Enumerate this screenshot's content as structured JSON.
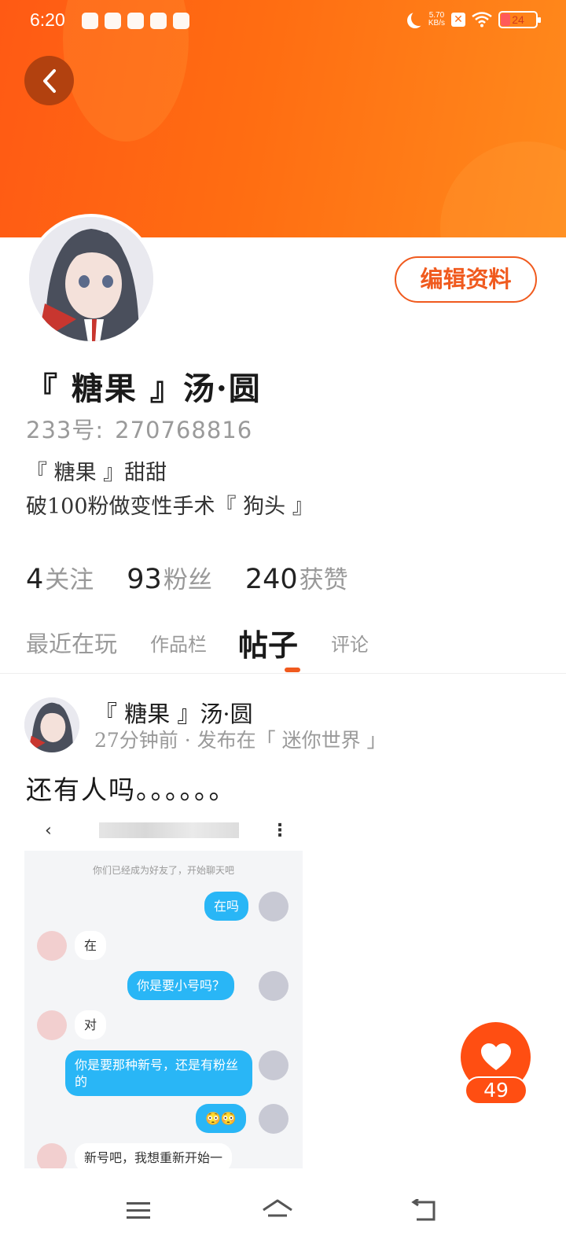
{
  "status_bar": {
    "time": "6:20",
    "net_speed_value": "5.70",
    "net_speed_unit": "KB/s",
    "battery": "24"
  },
  "profile": {
    "edit_label": "编辑资料",
    "username": "『 糖果 』汤·圆",
    "id_label": "233号:",
    "id_value": "270768816",
    "bio_line1": "『 糖果 』甜甜",
    "bio_line2": "破100粉做变性手术『 狗头 』"
  },
  "stats": [
    {
      "num": "4",
      "label": "关注"
    },
    {
      "num": "93",
      "label": "粉丝"
    },
    {
      "num": "240",
      "label": "获赞"
    }
  ],
  "tabs": [
    "最近在玩",
    "作品栏",
    "帖子",
    "评论"
  ],
  "active_tab": "帖子",
  "post": {
    "author": "『 糖果 』汤·圆",
    "meta": "27分钟前 · 发布在「 迷你世界 」",
    "text": "还有人吗。。。。。。",
    "likes": "49"
  },
  "chat_screenshot": {
    "system": "你们已经成为好友了，开始聊天吧",
    "messages": [
      {
        "from": "me",
        "text": "在吗"
      },
      {
        "from": "them",
        "text": "在"
      },
      {
        "from": "me",
        "text": "你是要小号吗？"
      },
      {
        "from": "them",
        "text": "对"
      },
      {
        "from": "me",
        "text": "你是要那种新号，还是有粉丝的"
      },
      {
        "from": "me",
        "text": "😳😳"
      },
      {
        "from": "them",
        "text": "新号吧，我想重新开始一"
      }
    ]
  },
  "colors": {
    "accent": "#f05a1e",
    "banner": "#ff6d12",
    "chat_bubble": "#29b6f6"
  }
}
